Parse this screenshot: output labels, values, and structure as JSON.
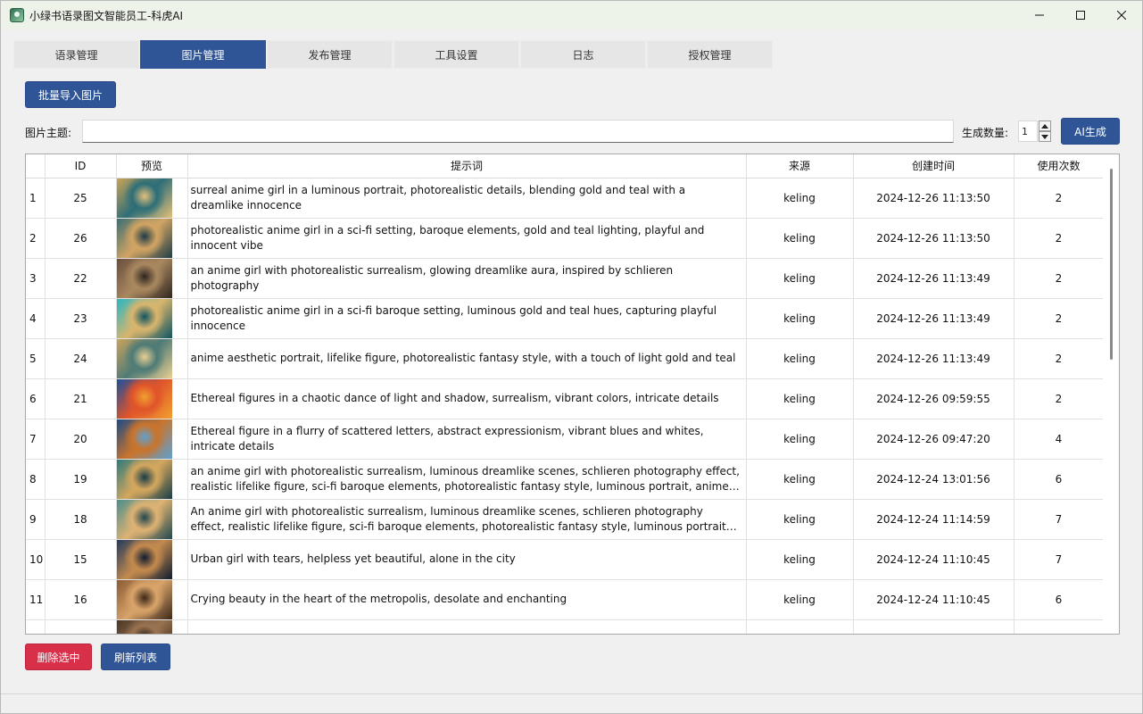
{
  "window": {
    "title": "小绿书语录图文智能员工-科虎AI"
  },
  "tabs": [
    {
      "label": "语录管理",
      "active": false
    },
    {
      "label": "图片管理",
      "active": true
    },
    {
      "label": "发布管理",
      "active": false
    },
    {
      "label": "工具设置",
      "active": false
    },
    {
      "label": "日志",
      "active": false
    },
    {
      "label": "授权管理",
      "active": false
    }
  ],
  "toolbar": {
    "import_label": "批量导入图片",
    "topic_label": "图片主题:",
    "topic_value": "",
    "count_label": "生成数量:",
    "count_value": "1",
    "generate_label": "AI生成"
  },
  "table": {
    "columns": [
      "ID",
      "预览",
      "提示词",
      "来源",
      "创建时间",
      "使用次数"
    ],
    "rows": [
      {
        "row": "1",
        "id": "25",
        "thumb": [
          "#c9a457",
          "#2e6e78",
          "#e3c07a"
        ],
        "prompt": "surreal anime girl in a luminous portrait, photorealistic details, blending gold and teal with a dreamlike innocence",
        "source": "keling",
        "created": "2024-12-26 11:13:50",
        "uses": "2"
      },
      {
        "row": "2",
        "id": "26",
        "thumb": [
          "#3a6f74",
          "#d2a463",
          "#1f3c46"
        ],
        "prompt": "photorealistic anime girl in a sci-fi setting, baroque elements, gold and teal lighting, playful and innocent vibe",
        "source": "keling",
        "created": "2024-12-26 11:13:50",
        "uses": "2"
      },
      {
        "row": "3",
        "id": "22",
        "thumb": [
          "#6a4e3c",
          "#a9885f",
          "#2f2620"
        ],
        "prompt": "an anime girl with photorealistic surrealism, glowing dreamlike aura, inspired by schlieren photography",
        "source": "keling",
        "created": "2024-12-26 11:13:49",
        "uses": "2"
      },
      {
        "row": "4",
        "id": "23",
        "thumb": [
          "#2ab7c2",
          "#d9b56d",
          "#0f5562"
        ],
        "prompt": "photorealistic anime girl in a sci-fi baroque setting, luminous gold and teal hues, capturing playful innocence",
        "source": "keling",
        "created": "2024-12-26 11:13:49",
        "uses": "2"
      },
      {
        "row": "5",
        "id": "24",
        "thumb": [
          "#caa35c",
          "#4e7b76",
          "#e9cf92"
        ],
        "prompt": "anime aesthetic portrait, lifelike figure, photorealistic fantasy style, with a touch of light gold and teal",
        "source": "keling",
        "created": "2024-12-26 11:13:49",
        "uses": "2"
      },
      {
        "row": "6",
        "id": "21",
        "thumb": [
          "#1d4f9b",
          "#e0542a",
          "#f0a030"
        ],
        "prompt": "Ethereal figures in a chaotic dance of light and shadow, surrealism, vibrant colors, intricate details",
        "source": "keling",
        "created": "2024-12-26 09:59:55",
        "uses": "2"
      },
      {
        "row": "7",
        "id": "20",
        "thumb": [
          "#1c4a86",
          "#c9742c",
          "#5fa0d0"
        ],
        "prompt": "Ethereal figure in a flurry of scattered letters, abstract expressionism, vibrant blues and whites, intricate details",
        "source": "keling",
        "created": "2024-12-26 09:47:20",
        "uses": "4"
      },
      {
        "row": "8",
        "id": "19",
        "thumb": [
          "#2d7b7a",
          "#d4a75e",
          "#183d45"
        ],
        "prompt": "an anime girl with photorealistic surrealism, luminous dreamlike scenes, schlieren photography effect, realistic lifelike figure, sci-fi baroque elements, photorealistic fantasy style, luminous portrait, anime ...",
        "source": "keling",
        "created": "2024-12-24 13:01:56",
        "uses": "6"
      },
      {
        "row": "9",
        "id": "18",
        "thumb": [
          "#4b8f8a",
          "#deb273",
          "#22474d"
        ],
        "prompt": "An anime girl with photorealistic surrealism, luminous dreamlike scenes, schlieren photography effect, realistic lifelike figure, sci-fi baroque elements, photorealistic fantasy style, luminous portrait, anime ...",
        "source": "keling",
        "created": "2024-12-24 11:14:59",
        "uses": "7"
      },
      {
        "row": "10",
        "id": "15",
        "thumb": [
          "#233a5c",
          "#c48a4e",
          "#0f1c30"
        ],
        "prompt": "Urban girl with tears, helpless yet beautiful, alone in the city",
        "source": "keling",
        "created": "2024-12-24 11:10:45",
        "uses": "7"
      },
      {
        "row": "11",
        "id": "16",
        "thumb": [
          "#8a5a34",
          "#d9a46a",
          "#3c2718"
        ],
        "prompt": "Crying beauty in the heart of the metropolis, desolate and enchanting",
        "source": "keling",
        "created": "2024-12-24 11:10:45",
        "uses": "6"
      },
      {
        "row": "",
        "id": "",
        "thumb": [
          "#4a3626",
          "#9a7350",
          "#231810"
        ],
        "prompt": "",
        "source": "",
        "created": "",
        "uses": ""
      }
    ]
  },
  "footer": {
    "delete_label": "删除选中",
    "refresh_label": "刷新列表"
  },
  "colors": {
    "accent": "#2f5597",
    "danger": "#d9304a"
  }
}
